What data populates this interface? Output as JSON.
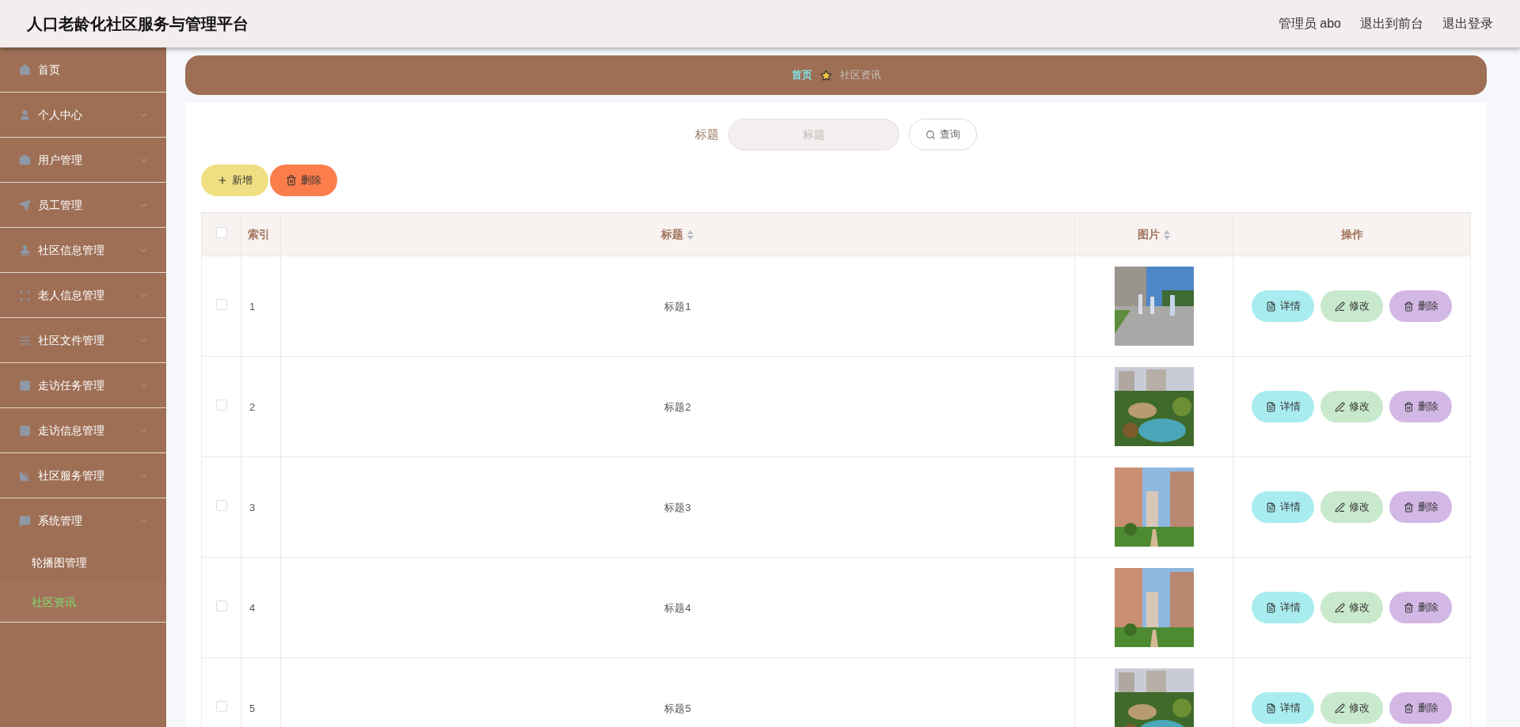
{
  "header": {
    "title": "人口老龄化社区服务与管理平台",
    "user": "管理员 abo",
    "links": [
      "退出到前台",
      "退出登录"
    ]
  },
  "sidebar": {
    "items": [
      {
        "label": "首页",
        "expandable": false
      },
      {
        "label": "个人中心",
        "expandable": true,
        "expanded": false
      },
      {
        "label": "用户管理",
        "expandable": true,
        "expanded": false
      },
      {
        "label": "员工管理",
        "expandable": true,
        "expanded": false
      },
      {
        "label": "社区信息管理",
        "expandable": true,
        "expanded": false
      },
      {
        "label": "老人信息管理",
        "expandable": true,
        "expanded": false
      },
      {
        "label": "社区文件管理",
        "expandable": true,
        "expanded": false
      },
      {
        "label": "走访任务管理",
        "expandable": true,
        "expanded": false
      },
      {
        "label": "走访信息管理",
        "expandable": true,
        "expanded": false
      },
      {
        "label": "社区服务管理",
        "expandable": true,
        "expanded": false
      },
      {
        "label": "系统管理",
        "expandable": true,
        "expanded": true,
        "children": [
          {
            "label": "轮播图管理",
            "selected": false
          },
          {
            "label": "社区资讯",
            "selected": true
          }
        ]
      }
    ]
  },
  "breadcrumb": [
    "首页",
    "社区资讯"
  ],
  "search": {
    "label": "标题",
    "placeholder": "标题",
    "button": "查询"
  },
  "actions": {
    "add": "新增",
    "delete": "删除"
  },
  "table": {
    "all_checked": false,
    "columns": [
      {
        "label": "索引",
        "sortable": false
      },
      {
        "label": "标题",
        "sortable": true
      },
      {
        "label": "图片",
        "sortable": true
      },
      {
        "label": "操作",
        "sortable": false
      }
    ],
    "rows": [
      {
        "checked": false,
        "index": "1",
        "title": "标题1",
        "buttons": [
          "详情",
          "修改",
          "删除"
        ]
      },
      {
        "checked": false,
        "index": "2",
        "title": "标题2",
        "buttons": [
          "详情",
          "修改",
          "删除"
        ]
      },
      {
        "checked": false,
        "index": "3",
        "title": "标题3",
        "buttons": [
          "详情",
          "修改",
          "删除"
        ]
      },
      {
        "checked": false,
        "index": "4",
        "title": "标题4",
        "buttons": [
          "详情",
          "修改",
          "删除"
        ]
      },
      {
        "checked": false,
        "index": "5",
        "title": "标题5",
        "buttons": [
          "详情",
          "修改",
          "删除"
        ]
      }
    ]
  }
}
